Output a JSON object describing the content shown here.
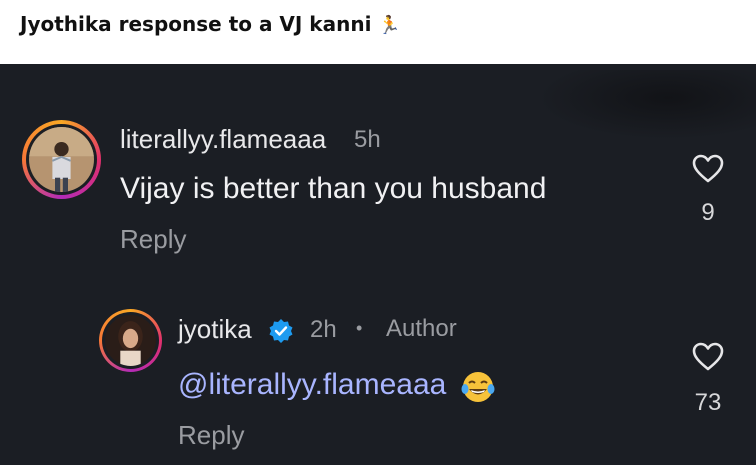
{
  "post": {
    "title": "Jyothika response to a VJ kanni",
    "title_emoji": "person-running-icon"
  },
  "colors": {
    "background": "#1b1e24",
    "mention": "#a9b5ff",
    "verified": "#1d9bf0",
    "muted": "#9a9ca1"
  },
  "comments": [
    {
      "username": "literallyy.flameaaa",
      "time": "5h",
      "text": "Vijay is better than you husband",
      "reply_label": "Reply",
      "like_count": "9"
    },
    {
      "username": "jyotika",
      "verified": true,
      "time": "2h",
      "separator": "•",
      "role": "Author",
      "mention": "@literallyy.flameaaa",
      "emoji": "face-with-tears-of-joy-icon",
      "reply_label": "Reply",
      "like_count": "73"
    }
  ]
}
